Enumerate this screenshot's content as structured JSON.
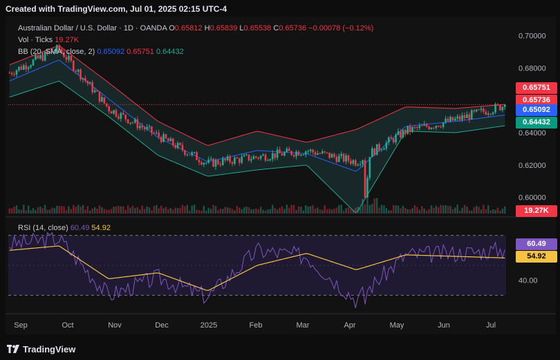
{
  "header": {
    "created_text": "Created with TradingView.com, Jul 01, 2025 02:15 UTC-4"
  },
  "legend": {
    "symbol": "Australian Dollar / U.S. Dollar · 1D · OANDA",
    "o_label": "O",
    "o": "0.65812",
    "h_label": "H",
    "h": "0.65839",
    "l_label": "L",
    "l": "0.65538",
    "c_label": "C",
    "c": "0.65736",
    "change": "−0.00078 (−0.12%)",
    "vol_label": "Vol · Ticks",
    "vol": "19.27K",
    "bb_label": "BB (20, SMA, close, 2)",
    "bb_mid": "0.65092",
    "bb_upper": "0.65751",
    "bb_lower": "0.64432",
    "rsi_label": "RSI (14, close)",
    "rsi": "60.49",
    "rsi_ma": "54.92"
  },
  "badges": {
    "bb_upper": "0.65751",
    "close": "0.65736",
    "bb_mid": "0.65092",
    "bb_lower": "0.64432",
    "volume": "19.27K",
    "rsi": "60.49",
    "rsi_ma": "54.92"
  },
  "colors": {
    "up": "#22ab94",
    "down": "#f23645",
    "bb_mid": "#2962ff",
    "bb_band_upper": "#f23645",
    "bb_band_lower": "#22ab94",
    "rsi": "#7e57c2",
    "rsi_ma": "#f5c242"
  },
  "footer": {
    "brand": "TradingView"
  },
  "chart_data": [
    {
      "type": "candlestick",
      "title": "Australian Dollar / U.S. Dollar · 1D · OANDA",
      "x_ticks": [
        "Sep",
        "Oct",
        "Nov",
        "Dec",
        "2025",
        "Feb",
        "Mar",
        "Apr",
        "May",
        "Jun",
        "Jul"
      ],
      "y_ticks": [
        "0.70000",
        "0.68000",
        "0.66000",
        "0.64000",
        "0.62000",
        "0.60000"
      ],
      "ylim": [
        0.59,
        0.705
      ],
      "grid": false,
      "series": [
        {
          "name": "Price",
          "x": [
            "Sep",
            "Oct",
            "Nov",
            "Dec",
            "2025",
            "Feb",
            "Mar",
            "Apr",
            "May",
            "Jun",
            "Jul"
          ],
          "values": [
            0.677,
            0.692,
            0.655,
            0.638,
            0.621,
            0.625,
            0.629,
            0.622,
            0.641,
            0.648,
            0.657
          ]
        },
        {
          "name": "BB upper",
          "x": [
            "Sep",
            "Oct",
            "Nov",
            "Dec",
            "2025",
            "Feb",
            "Mar",
            "Apr",
            "May",
            "Jun",
            "Jul"
          ],
          "values": [
            0.682,
            0.694,
            0.671,
            0.647,
            0.632,
            0.641,
            0.634,
            0.642,
            0.656,
            0.655,
            0.6575
          ]
        },
        {
          "name": "BB lower",
          "x": [
            "Sep",
            "Oct",
            "Nov",
            "Dec",
            "2025",
            "Feb",
            "Mar",
            "Apr",
            "May",
            "Jun",
            "Jul"
          ],
          "values": [
            0.662,
            0.672,
            0.65,
            0.626,
            0.613,
            0.617,
            0.62,
            0.59,
            0.641,
            0.64,
            0.6443
          ]
        },
        {
          "name": "BB basis",
          "x": [
            "Sep",
            "Oct",
            "Nov",
            "Dec",
            "2025",
            "Feb",
            "Mar",
            "Apr",
            "May",
            "Jun",
            "Jul"
          ],
          "values": [
            0.672,
            0.685,
            0.661,
            0.637,
            0.622,
            0.629,
            0.627,
            0.616,
            0.644,
            0.647,
            0.6509
          ]
        }
      ],
      "last_close": 0.65736
    },
    {
      "type": "line",
      "title": "RSI (14, close)",
      "y_ticks": [
        "40.00"
      ],
      "ylim": [
        20,
        80
      ],
      "levels": [
        70,
        30
      ],
      "series": [
        {
          "name": "RSI",
          "x": [
            "Sep",
            "Oct",
            "Nov",
            "Dec",
            "2025",
            "Feb",
            "Mar",
            "Apr",
            "May",
            "Jun",
            "Jul"
          ],
          "values": [
            64,
            68,
            30,
            42,
            29,
            60,
            56,
            27,
            57,
            58,
            60.49
          ]
        },
        {
          "name": "RSI MA",
          "x": [
            "Sep",
            "Oct",
            "Nov",
            "Dec",
            "2025",
            "Feb",
            "Mar",
            "Apr",
            "May",
            "Jun",
            "Jul"
          ],
          "values": [
            60,
            63,
            41,
            45,
            33,
            50,
            58,
            47,
            57,
            56,
            54.92
          ]
        }
      ]
    }
  ]
}
